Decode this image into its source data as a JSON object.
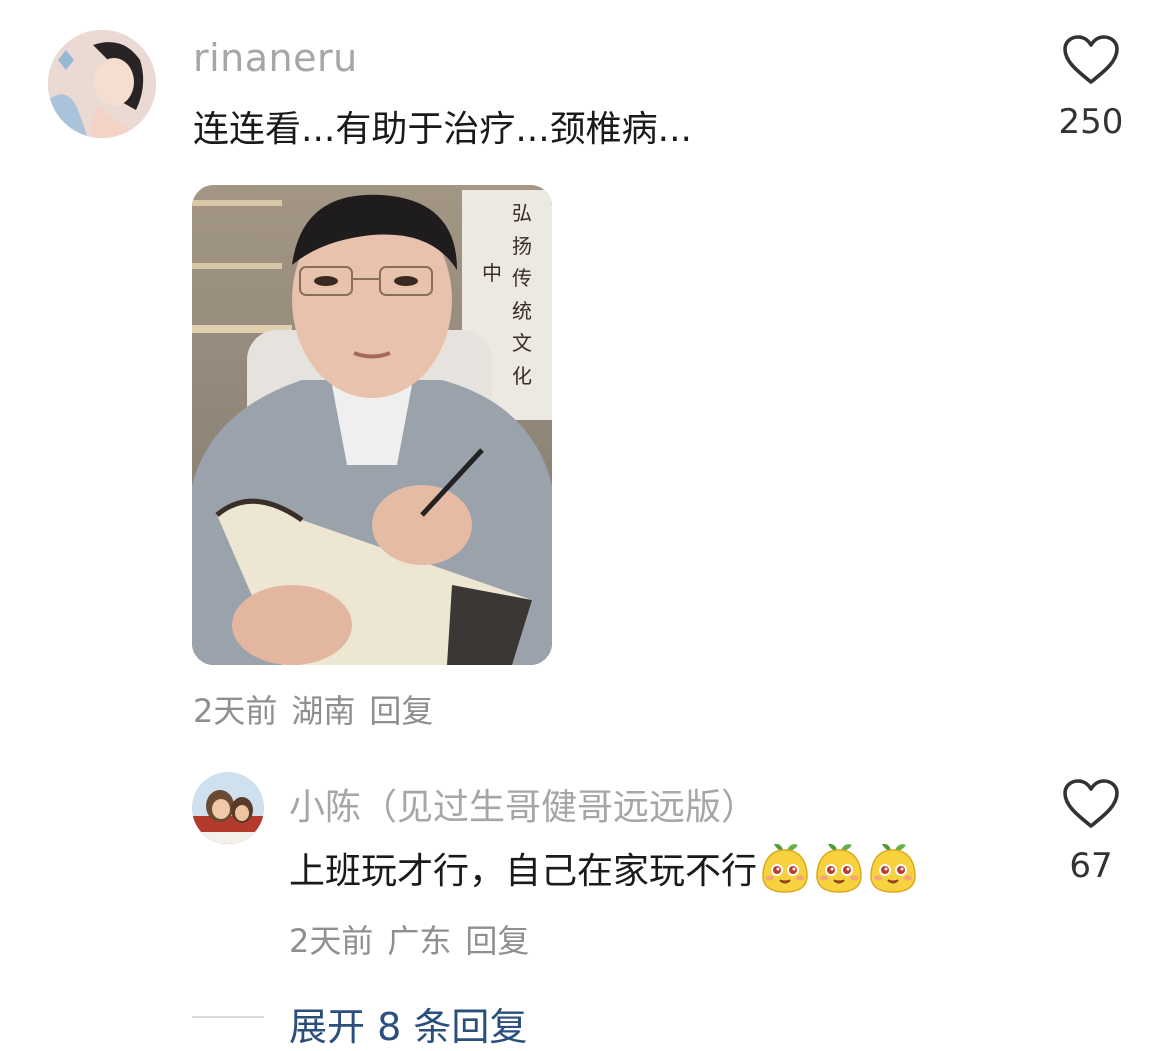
{
  "comment": {
    "username": "rinaneru",
    "text": "连连看...有助于治疗...颈椎病...",
    "likes": "250",
    "meta": {
      "time": "2天前",
      "location": "湖南",
      "reply_label": "回复"
    },
    "avatar_icon": "avatar-woman-portrait",
    "image_icon": "photo-man-writing-notebook"
  },
  "reply": {
    "username": "小陈（见过生哥健哥远远版）",
    "text": "上班玩才行，自己在家玩不行",
    "emoji_icon": "yellow-sprout-face-emoji",
    "emoji_count": 3,
    "likes": "67",
    "meta": {
      "time": "2天前",
      "location": "广东",
      "reply_label": "回复"
    },
    "avatar_icon": "avatar-cartoon-girl"
  },
  "expand": {
    "label": "展开 8 条回复"
  },
  "colors": {
    "username": "#a6a6a6",
    "meta": "#8f8f8f",
    "body_text": "#1a1a1a",
    "link": "#2b4f7c",
    "heart_outline": "#333333"
  }
}
